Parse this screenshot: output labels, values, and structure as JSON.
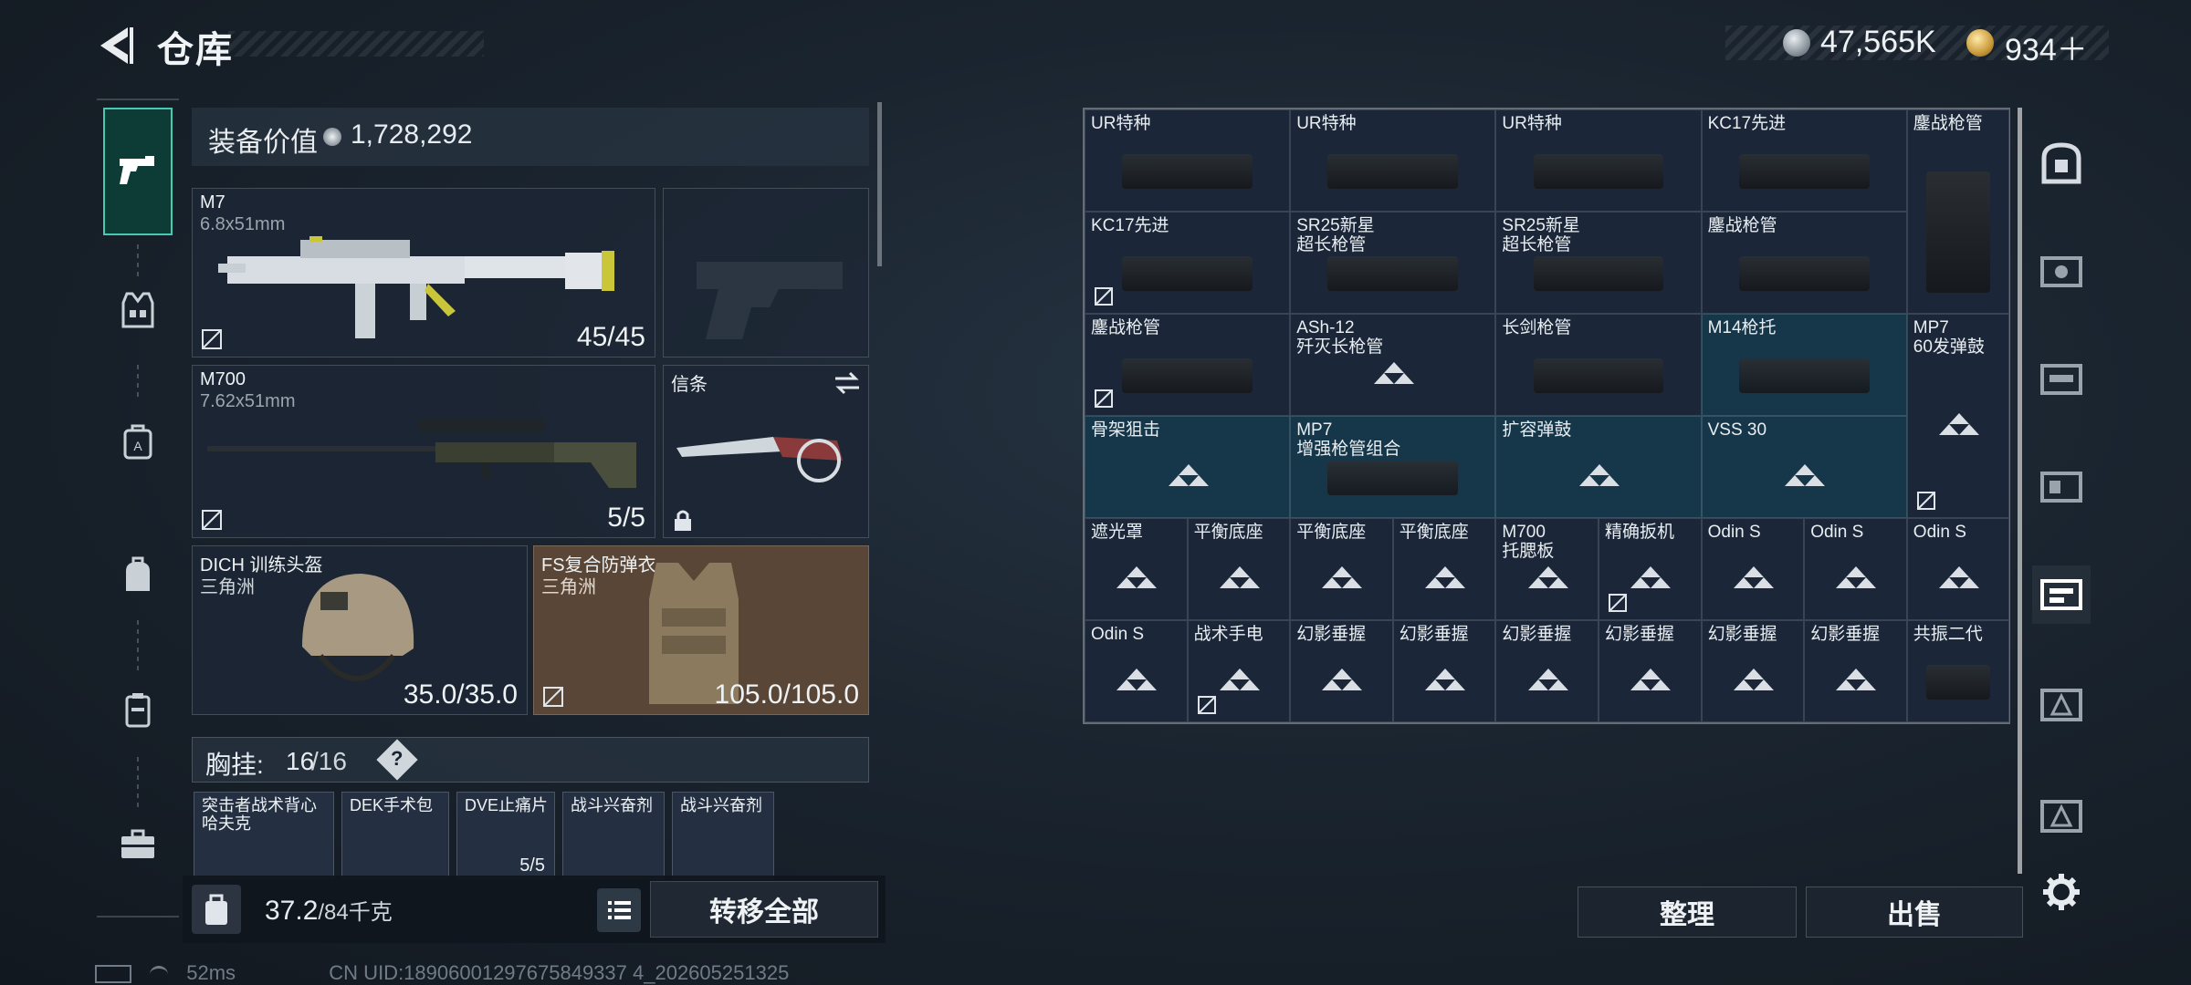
{
  "header": {
    "title": "仓库",
    "currency_silver": "47,565K",
    "currency_gold": "934＋"
  },
  "loadout": {
    "equip_value_label": "装备价值",
    "equip_value": "1,728,292",
    "primary": {
      "name": "M7",
      "caliber": "6.8x51mm",
      "ammo": "45/45"
    },
    "secondary": {
      "name": "M700",
      "caliber": "7.62x51mm",
      "ammo": "5/5"
    },
    "melee": {
      "name": "信条"
    },
    "helmet": {
      "name": "DICH 训练头盔",
      "faction": "三角洲",
      "durability": "35.0/35.0"
    },
    "armor": {
      "name": "FS复合防弹衣",
      "faction": "三角洲",
      "durability": "105.0/105.0"
    },
    "chest_rig_label": "胸挂:",
    "chest_rig_count": "16",
    "chest_rig_max": "/16",
    "chest_rig_items": [
      {
        "name": "突击者战术背心\n哈夫克",
        "count": ""
      },
      {
        "name": "DEK手术包",
        "count": ""
      },
      {
        "name": "DVE止痛片",
        "count": "5/5"
      },
      {
        "name": "战斗兴奋剂",
        "count": ""
      },
      {
        "name": "战斗兴奋剂",
        "count": ""
      }
    ],
    "weight": "37.2",
    "weight_max": "/84千克",
    "transfer_all": "转移全部"
  },
  "storage": {
    "cells": [
      {
        "label": "UR特种"
      },
      {
        "label": "UR特种"
      },
      {
        "label": "UR特种"
      },
      {
        "label": "KC17先进"
      },
      {
        "label": "鏖战枪管"
      },
      {
        "label": "KC17先进"
      },
      {
        "label": "SR25新星\n超长枪管"
      },
      {
        "label": "SR25新星\n超长枪管"
      },
      {
        "label": "鏖战枪管"
      },
      {
        "label": "鏖战枪管"
      },
      {
        "label": "ASh-12\n歼灭长枪管"
      },
      {
        "label": "长剑枪管"
      },
      {
        "label": "M14枪托"
      },
      {
        "label": "MP7\n60发弹鼓"
      },
      {
        "label": "骨架狙击"
      },
      {
        "label": "MP7\n增强枪管组合"
      },
      {
        "label": "扩容弹鼓"
      },
      {
        "label": "VSS 30"
      },
      {
        "label": "遮光罩"
      },
      {
        "label": "平衡底座"
      },
      {
        "label": "平衡底座"
      },
      {
        "label": "平衡底座"
      },
      {
        "label": "M700\n托腮板"
      },
      {
        "label": "精确扳机"
      },
      {
        "label": "Odin S"
      },
      {
        "label": "Odin S"
      },
      {
        "label": "Odin S"
      },
      {
        "label": "Odin S"
      },
      {
        "label": "战术手电"
      },
      {
        "label": "幻影垂握"
      },
      {
        "label": "幻影垂握"
      },
      {
        "label": "幻影垂握"
      },
      {
        "label": "幻影垂握"
      },
      {
        "label": "幻影垂握"
      },
      {
        "label": "幻影垂握"
      },
      {
        "label": "共振二代"
      }
    ]
  },
  "actions": {
    "sort": "整理",
    "sell": "出售"
  },
  "status": {
    "ping": "52ms",
    "uid": "CN UID:18906001297675849337 4_202605251325"
  },
  "icons": [
    "back-arrow-icon",
    "pistol-icon",
    "vest-icon",
    "backpack-icon",
    "bag-icon",
    "case-icon",
    "toolbox-icon",
    "safe-icon",
    "gear-icon"
  ],
  "colors": {
    "accent_teal": "#49c9b1",
    "teal_cell": "#16374a",
    "cell": "#1b2638",
    "armor_card": "#5a4636"
  }
}
